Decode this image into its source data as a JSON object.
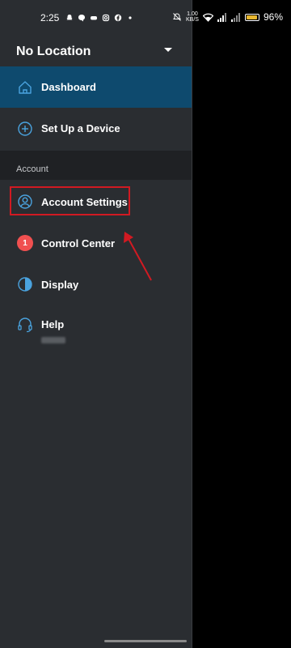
{
  "status_bar": {
    "time": "2:25",
    "net_speed_value": "1.00",
    "net_speed_unit": "KB/S",
    "battery": "96%",
    "battery_level": 0.96,
    "battery_color": "#e8b730"
  },
  "location": {
    "title": "No Location"
  },
  "menu": {
    "dashboard": "Dashboard",
    "setup": "Set Up a Device",
    "account_section": "Account",
    "account_settings": "Account Settings",
    "control_center": "Control Center",
    "control_center_badge": "1",
    "display": "Display",
    "help": "Help"
  },
  "colors": {
    "accent_active": "#0e4a6e",
    "icon_blue": "#4aa3df",
    "highlight_red": "#d11a22",
    "badge_red": "#f05050"
  }
}
